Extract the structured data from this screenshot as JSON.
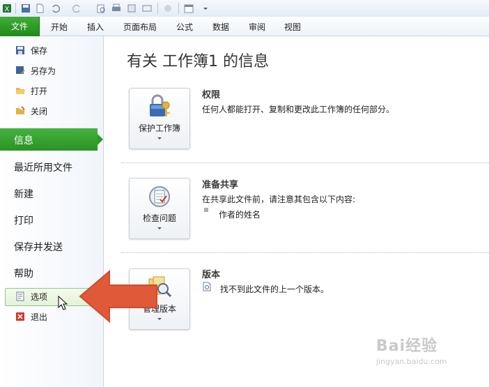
{
  "ribbon": {
    "file_tab": "文件",
    "tabs": [
      "开始",
      "插入",
      "页面布局",
      "公式",
      "数据",
      "审阅",
      "视图"
    ]
  },
  "nav": {
    "small_items": [
      {
        "label": "保存",
        "icon": "save-icon"
      },
      {
        "label": "另存为",
        "icon": "save-as-icon"
      },
      {
        "label": "打开",
        "icon": "open-folder-icon"
      },
      {
        "label": "关闭",
        "icon": "close-folder-icon"
      }
    ],
    "info": "信息",
    "big_items": [
      "最近所用文件",
      "新建",
      "打印",
      "保存并发送",
      "帮助"
    ],
    "options": "选项",
    "exit": "退出"
  },
  "main": {
    "title": "有关 工作簿1 的信息",
    "sections": [
      {
        "button": "保护工作簿",
        "title": "权限",
        "desc": "任何人都能打开、复制和更改此工作簿的任何部分。",
        "icon": "lock-key-icon"
      },
      {
        "button": "检查问题",
        "title": "准备共享",
        "desc": "在共享此文件前，请注意其包含以下内容:",
        "bullet": "作者的姓名",
        "icon": "checklist-icon"
      },
      {
        "button": "管理版本",
        "title": "版本",
        "desc": "找不到此文件的上一个版本。",
        "icon": "versions-icon"
      }
    ]
  },
  "watermark": {
    "brand": "Bai经验",
    "url": "jingyan.baidu.com"
  },
  "colors": {
    "accent_green": "#2a9325",
    "arrow": "#e05a3a"
  }
}
